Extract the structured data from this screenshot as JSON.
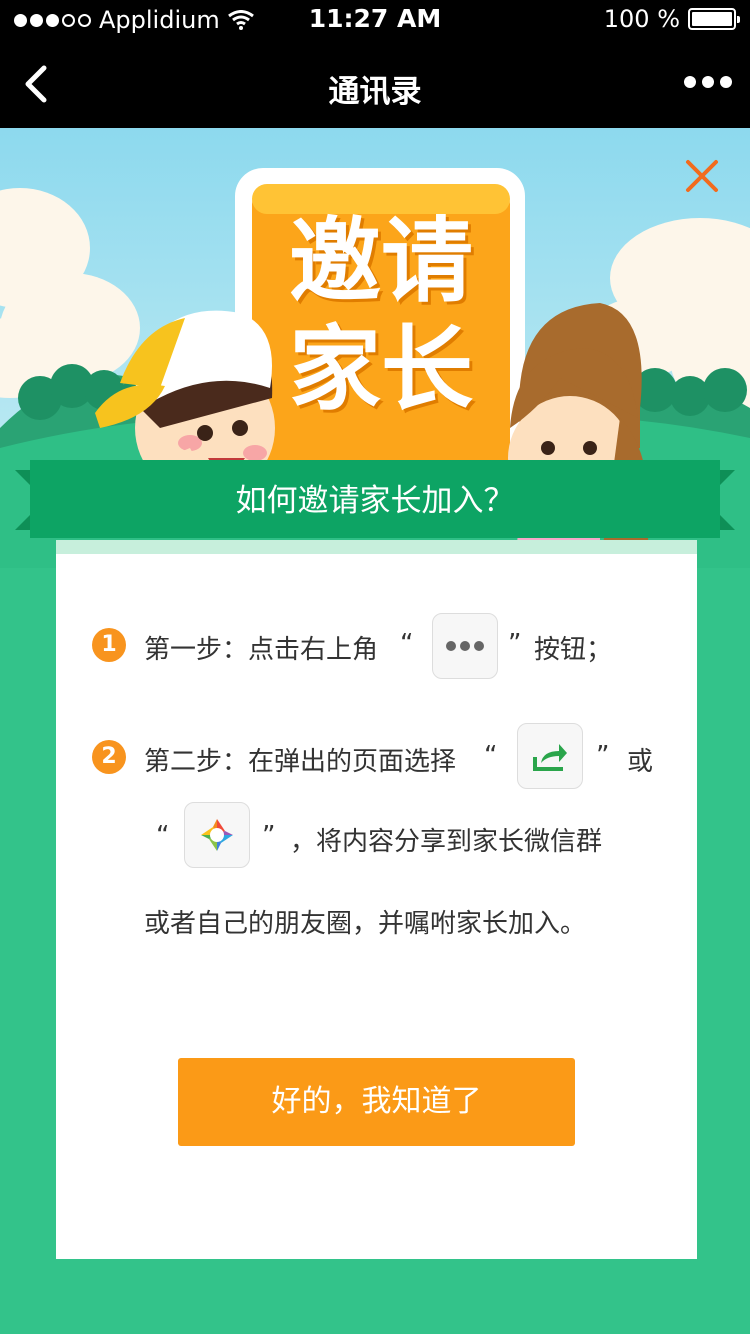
{
  "status_bar": {
    "carrier": "Applidium",
    "time": "11:27 AM",
    "battery": "100 %"
  },
  "nav": {
    "title": "通讯录"
  },
  "hero": {
    "banner_line1": "邀请",
    "banner_line2": "家长"
  },
  "ribbon": {
    "title": "如何邀请家长加入？"
  },
  "steps": {
    "step1_num": "1",
    "step1_text": "第一步：点击右上角",
    "step1_after": "按钮；",
    "step2_num": "2",
    "step2_text": "第二步：在弹出的页面选择",
    "step2_or": "或",
    "step2_line2": "，将内容分享到家长微信群",
    "step2_line3": "或者自己的朋友圈，并嘱咐家长加入。",
    "open_quote": "“",
    "close_quote": "”"
  },
  "ok_button": "好的，我知道了",
  "colors": {
    "accent_orange": "#fb9a17",
    "ribbon_green": "#0da464",
    "bg_green": "#33c38a"
  }
}
